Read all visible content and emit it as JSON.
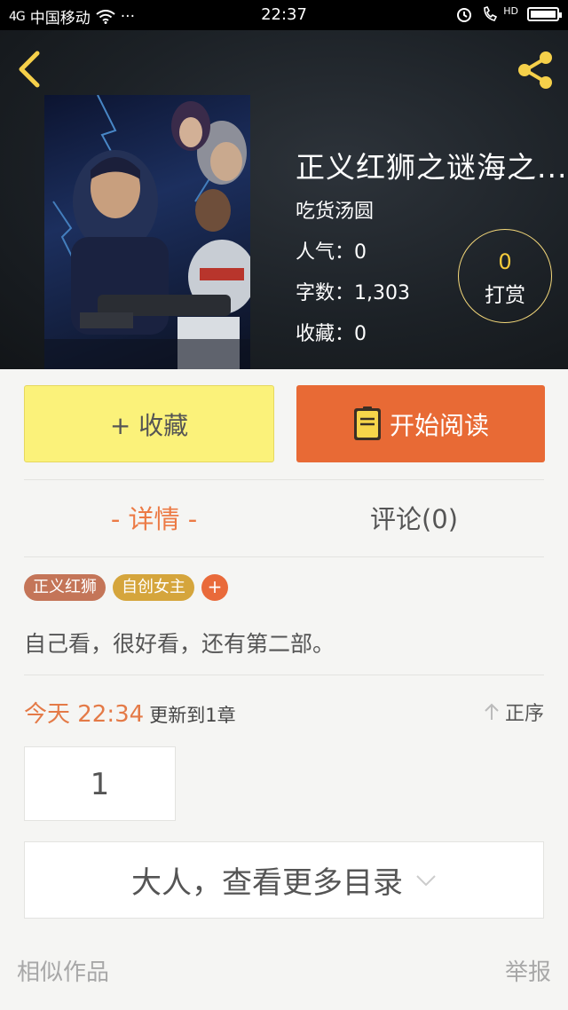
{
  "status_bar": {
    "signal": "4G",
    "carrier": "中国移动",
    "dots": "···",
    "time": "22:37",
    "hd": "HD"
  },
  "book": {
    "title": "正义红狮之谜海之...",
    "author": "吃货汤圆",
    "popularity": "人气：0",
    "word_count": "字数：1,303",
    "favorites": "收藏：0"
  },
  "reward": {
    "count": "0",
    "label": "打赏"
  },
  "actions": {
    "collect_label": "+ 收藏",
    "read_label": "开始阅读"
  },
  "tabs": {
    "detail": "- 详情 -",
    "comment": "评论(0)"
  },
  "tags": [
    "正义红狮",
    "自创女主"
  ],
  "tag_add": "+",
  "synopsis": "自己看，很好看，还有第二部。",
  "update": {
    "date": "今天 22:34",
    "text": "更新到1章",
    "sort_label": "正序"
  },
  "chapters": [
    "1"
  ],
  "more_catalog": "大人，查看更多目录",
  "footer": {
    "similar": "相似作品",
    "report": "举报"
  },
  "colors": {
    "accent_orange": "#e86a35",
    "collect_yellow": "#fbf27a",
    "reward_gold": "#f6cb3c"
  }
}
